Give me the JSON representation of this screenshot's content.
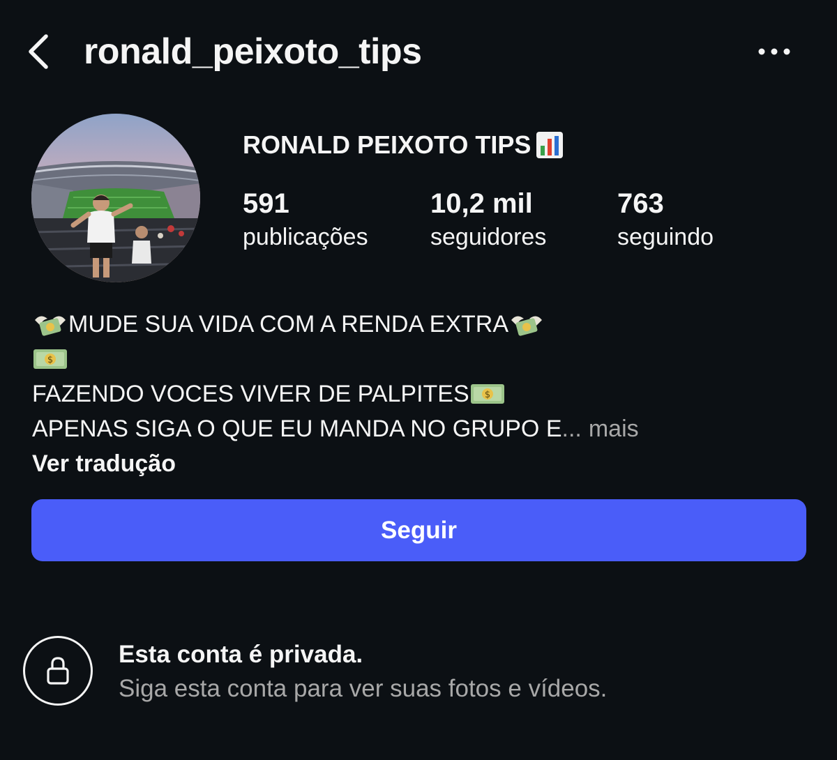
{
  "header": {
    "username": "ronald_peixoto_tips",
    "back_icon": "chevron-left-icon",
    "more_icon": "more-horizontal-icon"
  },
  "profile": {
    "display_name": "RONALD PEIXOTO TIPS",
    "name_emoji": "bar-chart-emoji",
    "stats": [
      {
        "value": "591",
        "label": "publicações"
      },
      {
        "value": "10,2 mil",
        "label": "seguidores"
      },
      {
        "value": "763",
        "label": "seguindo"
      }
    ]
  },
  "bio": {
    "line1": "MUDE SUA VIDA COM A RENDA EXTRA",
    "line3": "FAZENDO VOCES VIVER DE PALPITES",
    "line4": "APENAS SIGA O QUE EU MANDA NO GRUPO E",
    "ellipsis": "...",
    "more_label": "mais",
    "translate_label": "Ver tradução"
  },
  "follow_button": {
    "label": "Seguir",
    "color": "#4a5df9"
  },
  "private": {
    "title": "Esta conta é privada.",
    "subtitle": "Siga esta conta para ver suas fotos e vídeos.",
    "icon": "lock-icon"
  },
  "colors": {
    "background": "#0c1014",
    "text": "#f5f5f5",
    "muted": "#a8a8a8"
  }
}
